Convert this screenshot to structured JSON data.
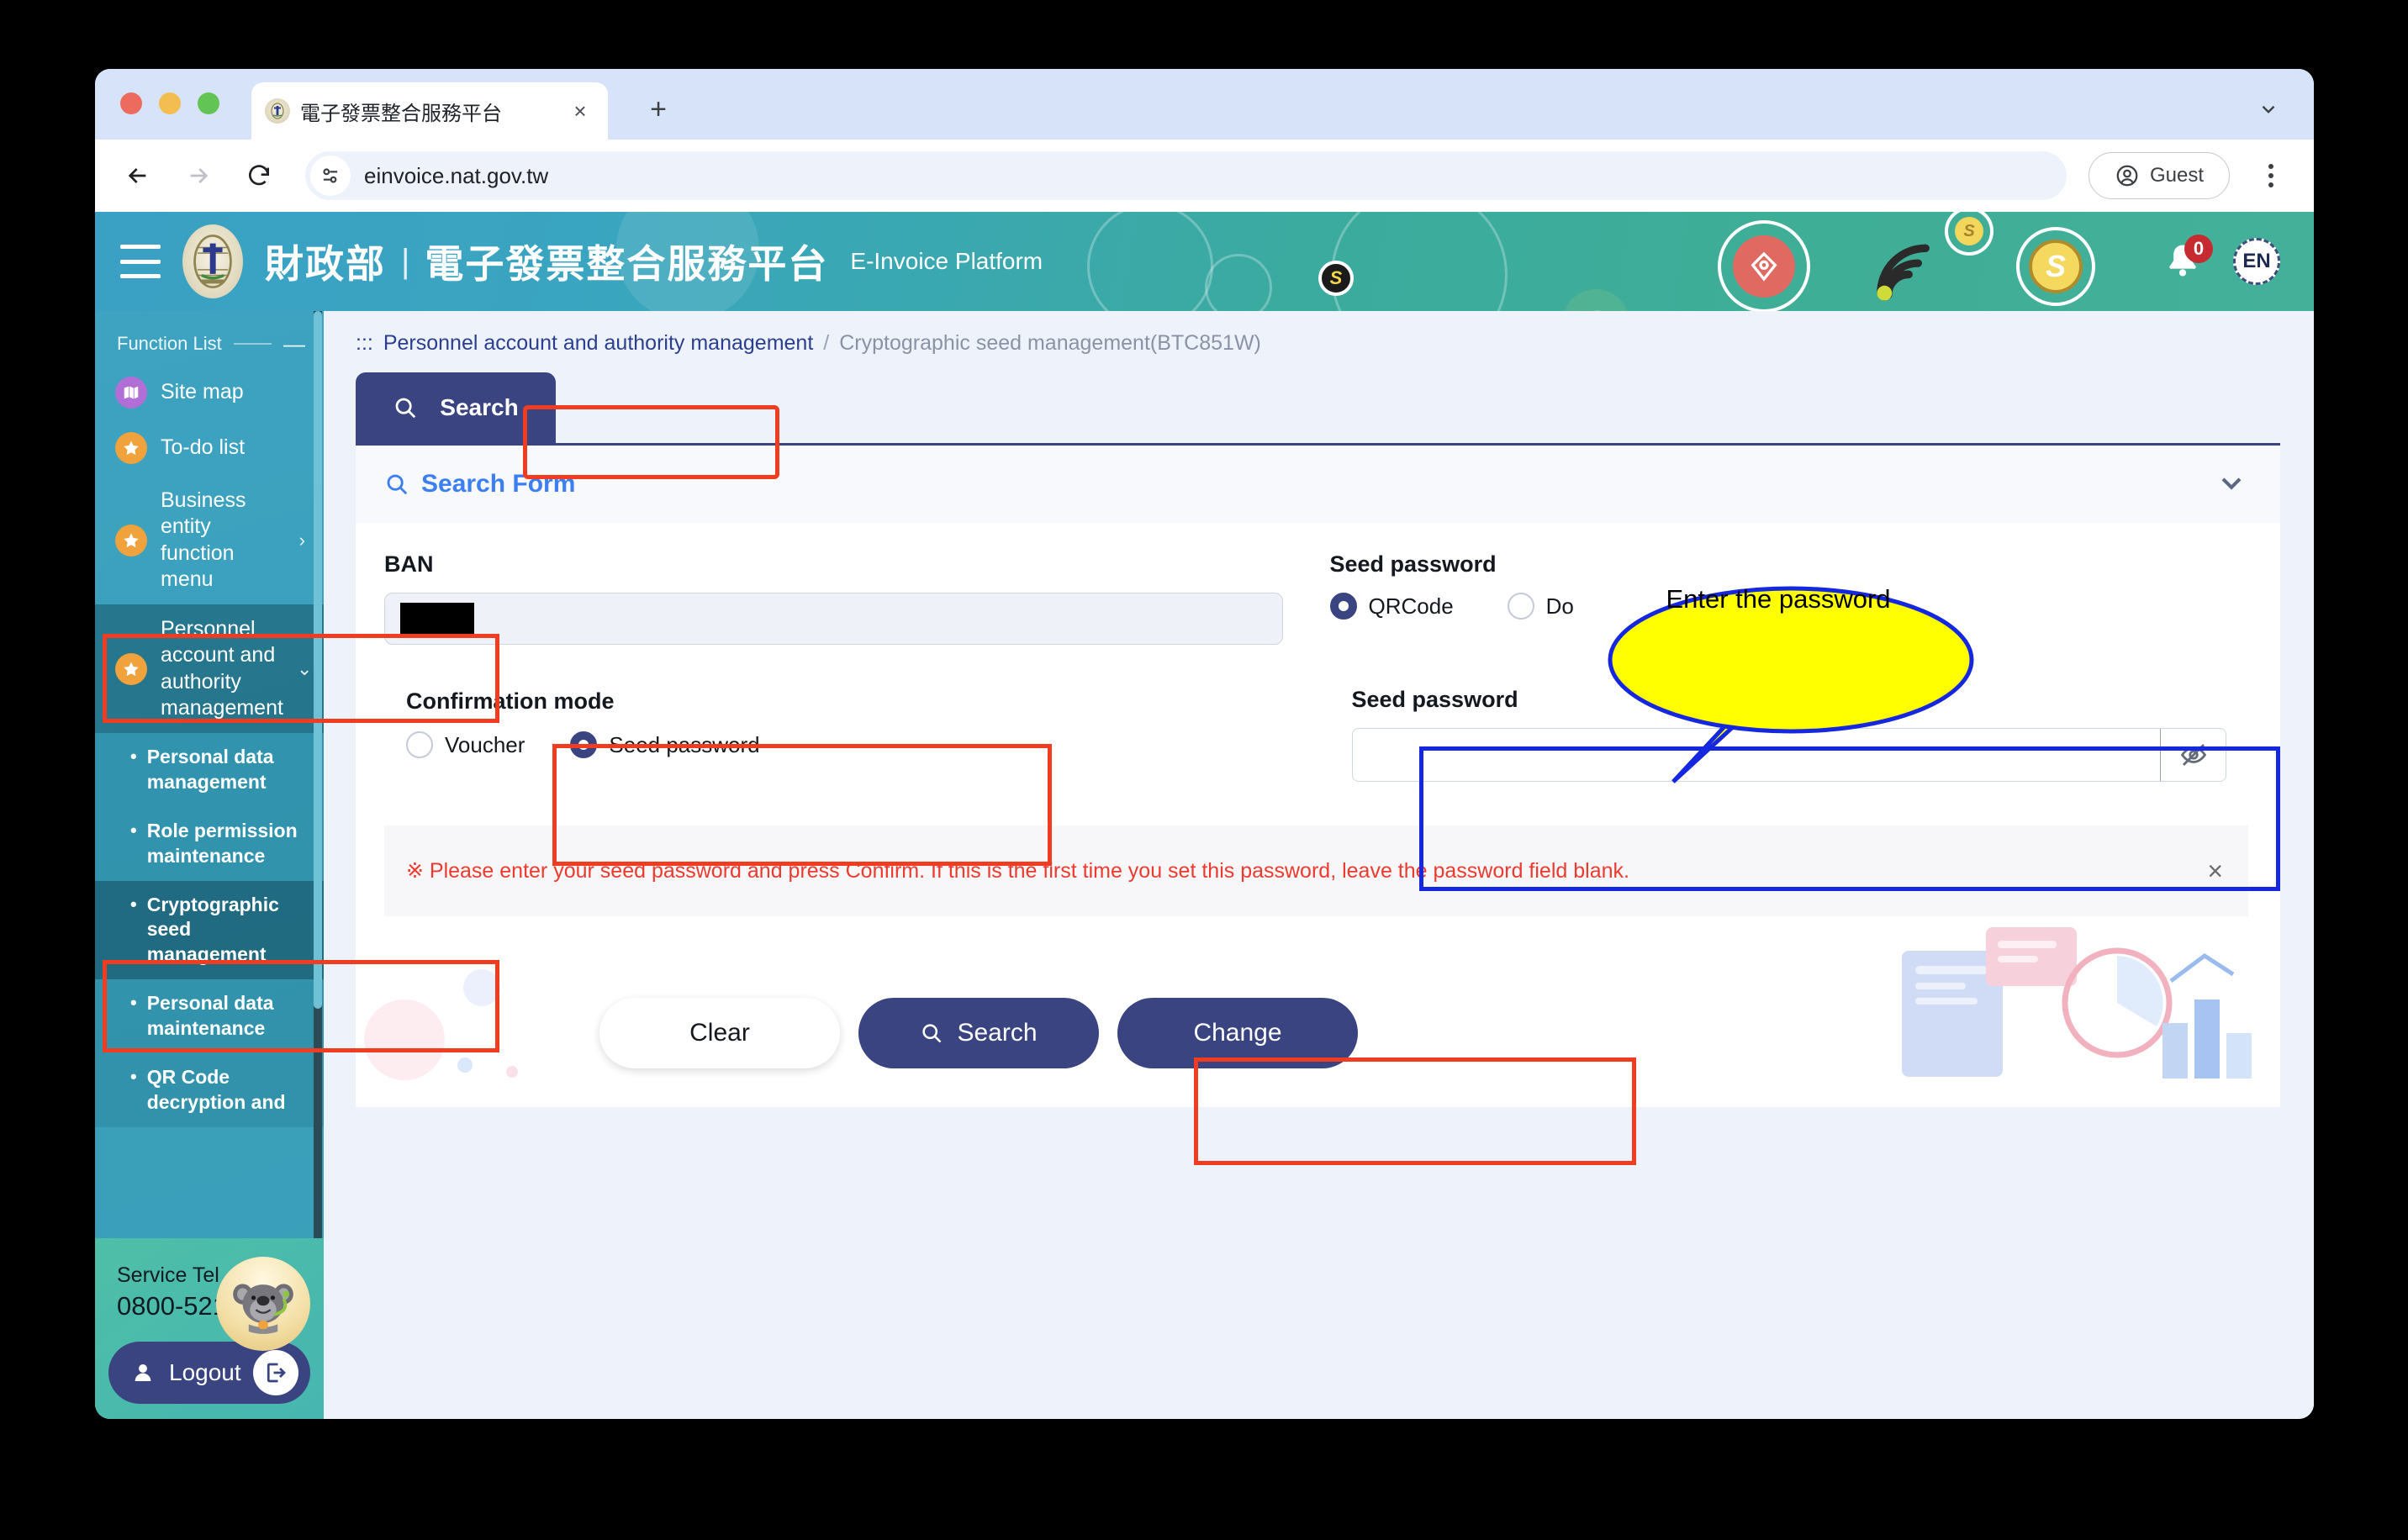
{
  "browser": {
    "tab": {
      "title": "電子發票整合服務平台",
      "favicon": "mof-seal-icon",
      "close": "×"
    },
    "new_tab": "+",
    "url": "einvoice.nat.gov.tw",
    "profile_label": "Guest"
  },
  "header": {
    "logo_alt": "mof-seal-icon",
    "org": "財政部",
    "divider": "|",
    "platform_zh": "電子發票整合服務平台",
    "platform_en": "E-Invoice Platform",
    "notification_count": "0",
    "language": "EN"
  },
  "sidebar": {
    "heading": "Function List",
    "collapse_glyph": "—",
    "items": [
      {
        "label": "Site map",
        "icon": "map-icon",
        "icon_color": "purple"
      },
      {
        "label": "To-do list",
        "icon": "star-icon",
        "icon_color": "orange"
      },
      {
        "label": "Business entity function menu",
        "icon": "star-icon",
        "icon_color": "orange",
        "chevron": "›"
      },
      {
        "label": "Personnel account and authority management",
        "icon": "star-icon",
        "icon_color": "orange",
        "chevron": "⌄",
        "active": true
      }
    ],
    "submenu": [
      {
        "label": "Personal data management"
      },
      {
        "label": "Role permission maintenance"
      },
      {
        "label": "Cryptographic seed management",
        "selected": true
      },
      {
        "label": "Personal data maintenance"
      },
      {
        "label": "QR Code decryption and"
      }
    ],
    "footer": {
      "service_tel_label": "Service Tel",
      "service_tel_number": "0800-521-988",
      "logout_label": "Logout"
    }
  },
  "breadcrumb": {
    "lead": ":::",
    "parent": "Personnel account and authority management",
    "separator": "/",
    "current": "Cryptographic seed management(BTC851W)"
  },
  "tabs": [
    {
      "label": "Search",
      "icon": "search-icon",
      "active": true
    }
  ],
  "panel": {
    "title": "Search Form",
    "title_icon": "search-icon",
    "collapse_icon": "chevron-down-icon"
  },
  "form": {
    "ban": {
      "label": "BAN",
      "value": "",
      "redacted": true
    },
    "seed_password_type": {
      "label": "Seed password",
      "options": [
        {
          "label": "QRCode",
          "selected": true
        },
        {
          "label": "Do",
          "selected": false
        }
      ]
    },
    "confirmation_mode": {
      "label": "Confirmation mode",
      "options": [
        {
          "label": "Voucher",
          "selected": false
        },
        {
          "label": "Seed password",
          "selected": true
        }
      ]
    },
    "seed_password": {
      "label": "Seed password",
      "value": "",
      "toggle_icon": "eye-off-icon"
    }
  },
  "notice": {
    "text": "※ Please enter your seed password and press Confirm. If this is the first time you set this password, leave the password field blank.",
    "close": "×",
    "color": "#ed3a2e"
  },
  "buttons": [
    {
      "label": "Clear",
      "style": "secondary"
    },
    {
      "label": "Search",
      "style": "primary",
      "icon": "search-icon",
      "highlighted": true
    },
    {
      "label": "Change",
      "style": "primary"
    }
  ],
  "annotations": {
    "callout_text": "Enter the password",
    "callout_fill": "#ffff00",
    "callout_stroke": "#1528e0",
    "red_box_color": "#f03c20",
    "blue_box_color": "#1528e0"
  }
}
